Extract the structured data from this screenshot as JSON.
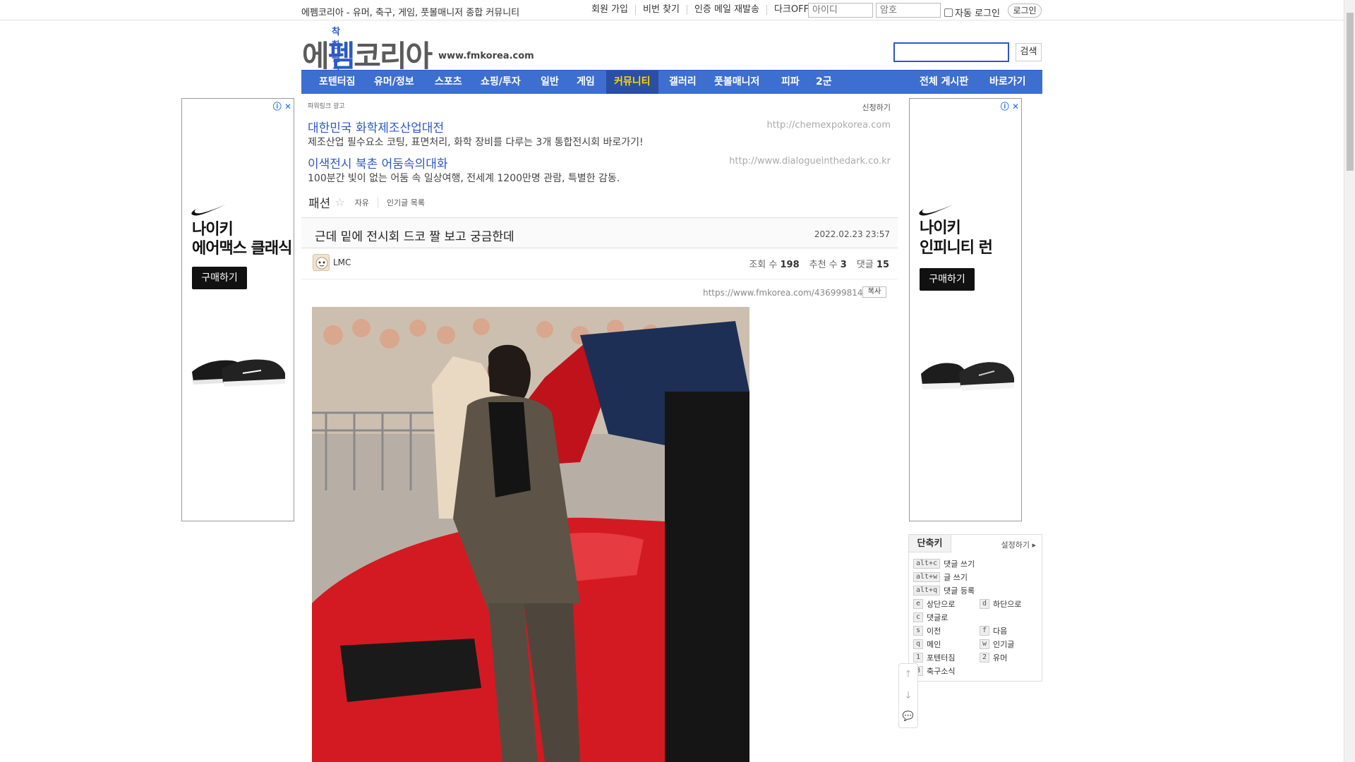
{
  "topbar": {
    "tagline": "에펨코리아 - 유머, 축구, 게임, 풋볼매니저 종합 커뮤니티",
    "links": [
      "회원 가입",
      "비번 찾기",
      "인증 메일 재발송",
      "다크OFF"
    ],
    "id_placeholder": "아이디",
    "pw_placeholder": "암호",
    "autologin_label": "자동 로그인",
    "login_label": "로그인"
  },
  "logo": {
    "sub": "착한 펨코",
    "main_a": "에",
    "main_b": "펨",
    "main_c": "코리아",
    "url": "www.fmkorea.com"
  },
  "search": {
    "button_label": "검색"
  },
  "nav": {
    "items": [
      "포텐터짐",
      "유머/정보",
      "스포츠",
      "쇼핑/투자",
      "일반",
      "게임",
      "커뮤니티",
      "갤러리",
      "풋볼매니저",
      "피파",
      "2군"
    ],
    "active": "커뮤니티",
    "right_items": [
      "전체 게시판",
      "바로가기"
    ]
  },
  "ads": {
    "left": {
      "headline1": "나이키",
      "headline2": "에어맥스 클래식",
      "cta": "구매하기"
    },
    "right": {
      "headline1": "나이키",
      "headline2": "인피니티 런",
      "cta": "구매하기"
    },
    "info_mark": "ⓘ ✕"
  },
  "sponsor": {
    "label": "파워링크 광고",
    "apply": "신청하기",
    "entries": [
      {
        "title": "대한민국 화학제조산업대전",
        "url": "http://chemexpokorea.com",
        "desc": "제조산업 필수요소 코팅, 표면처리, 화학 장비를 다루는 3개 통합전시회 바로가기!"
      },
      {
        "title": "이색전시 북촌 어둠속의대화",
        "url": "http://www.dialogueinthedark.co.kr",
        "desc": "100분간 빛이 없는 어둠 속 일상여행, 전세계 1200만명 관람, 특별한 감동."
      }
    ]
  },
  "board": {
    "name": "패션",
    "star": "☆",
    "tags": [
      "자유",
      "인기글 목록"
    ]
  },
  "post": {
    "title": "근데 밑에 전시회 드코 짤 보고 궁금한데",
    "date": "2022.02.23 23:57",
    "author": "LMC",
    "views_label": "조회 수",
    "views": "198",
    "recommend_label": "추천 수",
    "recommend": "3",
    "comments_label": "댓글",
    "comments": "15",
    "url": "https://www.fmkorea.com/4369998143",
    "copy_label": "복사"
  },
  "shortcuts": {
    "title": "단축키",
    "setting": "설정하기 ▸",
    "items": [
      {
        "key": "alt+c",
        "label": "댓글 쓰기"
      },
      {
        "key": "alt+w",
        "label": "글 쓰기"
      },
      {
        "key": "alt+q",
        "label": "댓글 등록"
      },
      {
        "key": "e",
        "label": "상단으로"
      },
      {
        "key": "d",
        "label": "하단으로"
      },
      {
        "key": "c",
        "label": "댓글로"
      },
      {
        "key": "s",
        "label": "이전"
      },
      {
        "key": "f",
        "label": "다음"
      },
      {
        "key": "q",
        "label": "메인"
      },
      {
        "key": "w",
        "label": "인기글"
      },
      {
        "key": "1",
        "label": "포텐터짐"
      },
      {
        "key": "2",
        "label": "유머"
      },
      {
        "key": "3",
        "label": "축구소식"
      }
    ]
  },
  "floating": {
    "up": "🡑",
    "down": "🡓",
    "comment": "💬"
  },
  "colors": {
    "brand": "#3d6fd0",
    "brand_dark": "#2a4fa3",
    "active_text": "#ffd800",
    "link": "#2d58c4"
  }
}
